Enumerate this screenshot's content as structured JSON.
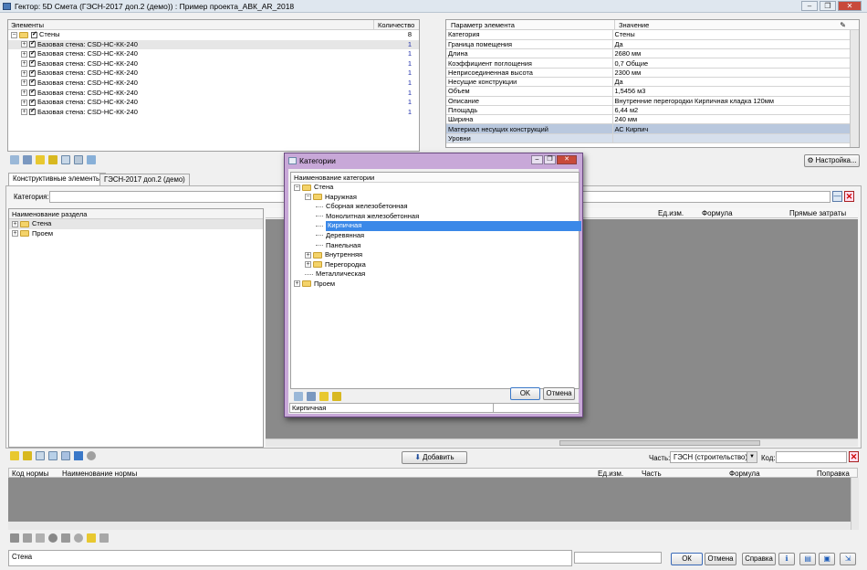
{
  "window": {
    "title": "Гектор: 5D Смета (ГЭСН-2017 доп.2 (демо)) : Пример проекта_АВК_AR_2018",
    "buttons": [
      "–",
      "❐",
      "✕"
    ]
  },
  "elements_tree": {
    "col_elements": "Элементы",
    "col_count": "Количество",
    "root": {
      "label": "Стены",
      "count": "8"
    },
    "items": [
      {
        "label": "Базовая стена: CSD-НС-КК-240",
        "count": "1"
      },
      {
        "label": "Базовая стена: CSD-НС-КК-240",
        "count": "1"
      },
      {
        "label": "Базовая стена: CSD-НС-КК-240",
        "count": "1"
      },
      {
        "label": "Базовая стена: CSD-НС-КК-240",
        "count": "1"
      },
      {
        "label": "Базовая стена: CSD-НС-КК-240",
        "count": "1"
      },
      {
        "label": "Базовая стена: CSD-НС-КК-240",
        "count": "1"
      },
      {
        "label": "Базовая стена: CSD-НС-КК-240",
        "count": "1"
      },
      {
        "label": "Базовая стена: CSD-НС-КК-240",
        "count": "1"
      }
    ]
  },
  "params": {
    "col_param": "Параметр элемента",
    "col_value": "Значение",
    "rows": [
      {
        "k": "Категория",
        "v": "Стены"
      },
      {
        "k": "Граница помещения",
        "v": "Да"
      },
      {
        "k": "Длина",
        "v": "2680 мм"
      },
      {
        "k": "Коэффициент поглощения",
        "v": "0,7 Общие"
      },
      {
        "k": "Неприсоединенная высота",
        "v": "2300 мм"
      },
      {
        "k": "Несущие конструкции",
        "v": "Да"
      },
      {
        "k": "Объем",
        "v": "1,5456 м3"
      },
      {
        "k": "Описание",
        "v": "Внутренние перегородки Кирпичная кладка 120мм"
      },
      {
        "k": "Площадь",
        "v": "6,44 м2"
      },
      {
        "k": "Ширина",
        "v": "240 мм"
      },
      {
        "k": "Материал несущих конструкций",
        "v": "АС Кирпич"
      },
      {
        "k": "Уровни",
        "v": ""
      }
    ]
  },
  "settings_button": "Настройка...",
  "tabs": [
    "Конструктивные элементы",
    "ГЭСН-2017 доп.2 (демо)"
  ],
  "category_label": "Категория:",
  "section_tree": {
    "header": "Наименование раздела",
    "items": [
      "Стена",
      "Проем"
    ]
  },
  "right_grid_cols": [
    "Ед.изм.",
    "Формула",
    "Прямые затраты"
  ],
  "add_button": "Добавить",
  "part_label": "Часть:",
  "part_value": "ГЭСН (строительство)",
  "code_label": "Код:",
  "norm_cols": [
    "Код нормы",
    "Наименование нормы",
    "Ед.изм.",
    "Часть",
    "Формула",
    "Поправка"
  ],
  "status_text": "Стена",
  "footer_buttons": {
    "ok": "ОК",
    "cancel": "Отмена",
    "help": "Справка"
  },
  "dialog": {
    "title": "Категории",
    "header": "Наименование категории",
    "tree": [
      {
        "label": "Стена",
        "level": 0,
        "type": "folder-open"
      },
      {
        "label": "Наружная",
        "level": 1,
        "type": "folder-open"
      },
      {
        "label": "Сборная железобетонная",
        "level": 2,
        "type": "leaf"
      },
      {
        "label": "Монолитная железобетонная",
        "level": 2,
        "type": "leaf"
      },
      {
        "label": "Кирпичная",
        "level": 2,
        "type": "leaf",
        "selected": true
      },
      {
        "label": "Деревянная",
        "level": 2,
        "type": "leaf"
      },
      {
        "label": "Панельная",
        "level": 2,
        "type": "leaf"
      },
      {
        "label": "Внутренняя",
        "level": 1,
        "type": "folder"
      },
      {
        "label": "Перегородка",
        "level": 1,
        "type": "folder"
      },
      {
        "label": "Металлическая",
        "level": 1,
        "type": "leaf"
      },
      {
        "label": "Проем",
        "level": 0,
        "type": "folder"
      }
    ],
    "ok": "OK",
    "cancel": "Отмена",
    "status": "Кирпичная"
  }
}
